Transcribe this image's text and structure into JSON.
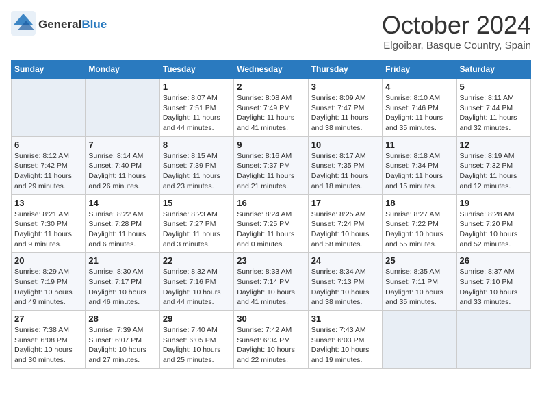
{
  "header": {
    "logo_general": "General",
    "logo_blue": "Blue",
    "month_title": "October 2024",
    "location": "Elgoibar, Basque Country, Spain"
  },
  "columns": [
    "Sunday",
    "Monday",
    "Tuesday",
    "Wednesday",
    "Thursday",
    "Friday",
    "Saturday"
  ],
  "weeks": [
    [
      {
        "day": "",
        "sunrise": "",
        "sunset": "",
        "daylight": ""
      },
      {
        "day": "",
        "sunrise": "",
        "sunset": "",
        "daylight": ""
      },
      {
        "day": "1",
        "sunrise": "Sunrise: 8:07 AM",
        "sunset": "Sunset: 7:51 PM",
        "daylight": "Daylight: 11 hours and 44 minutes."
      },
      {
        "day": "2",
        "sunrise": "Sunrise: 8:08 AM",
        "sunset": "Sunset: 7:49 PM",
        "daylight": "Daylight: 11 hours and 41 minutes."
      },
      {
        "day": "3",
        "sunrise": "Sunrise: 8:09 AM",
        "sunset": "Sunset: 7:47 PM",
        "daylight": "Daylight: 11 hours and 38 minutes."
      },
      {
        "day": "4",
        "sunrise": "Sunrise: 8:10 AM",
        "sunset": "Sunset: 7:46 PM",
        "daylight": "Daylight: 11 hours and 35 minutes."
      },
      {
        "day": "5",
        "sunrise": "Sunrise: 8:11 AM",
        "sunset": "Sunset: 7:44 PM",
        "daylight": "Daylight: 11 hours and 32 minutes."
      }
    ],
    [
      {
        "day": "6",
        "sunrise": "Sunrise: 8:12 AM",
        "sunset": "Sunset: 7:42 PM",
        "daylight": "Daylight: 11 hours and 29 minutes."
      },
      {
        "day": "7",
        "sunrise": "Sunrise: 8:14 AM",
        "sunset": "Sunset: 7:40 PM",
        "daylight": "Daylight: 11 hours and 26 minutes."
      },
      {
        "day": "8",
        "sunrise": "Sunrise: 8:15 AM",
        "sunset": "Sunset: 7:39 PM",
        "daylight": "Daylight: 11 hours and 23 minutes."
      },
      {
        "day": "9",
        "sunrise": "Sunrise: 8:16 AM",
        "sunset": "Sunset: 7:37 PM",
        "daylight": "Daylight: 11 hours and 21 minutes."
      },
      {
        "day": "10",
        "sunrise": "Sunrise: 8:17 AM",
        "sunset": "Sunset: 7:35 PM",
        "daylight": "Daylight: 11 hours and 18 minutes."
      },
      {
        "day": "11",
        "sunrise": "Sunrise: 8:18 AM",
        "sunset": "Sunset: 7:34 PM",
        "daylight": "Daylight: 11 hours and 15 minutes."
      },
      {
        "day": "12",
        "sunrise": "Sunrise: 8:19 AM",
        "sunset": "Sunset: 7:32 PM",
        "daylight": "Daylight: 11 hours and 12 minutes."
      }
    ],
    [
      {
        "day": "13",
        "sunrise": "Sunrise: 8:21 AM",
        "sunset": "Sunset: 7:30 PM",
        "daylight": "Daylight: 11 hours and 9 minutes."
      },
      {
        "day": "14",
        "sunrise": "Sunrise: 8:22 AM",
        "sunset": "Sunset: 7:28 PM",
        "daylight": "Daylight: 11 hours and 6 minutes."
      },
      {
        "day": "15",
        "sunrise": "Sunrise: 8:23 AM",
        "sunset": "Sunset: 7:27 PM",
        "daylight": "Daylight: 11 hours and 3 minutes."
      },
      {
        "day": "16",
        "sunrise": "Sunrise: 8:24 AM",
        "sunset": "Sunset: 7:25 PM",
        "daylight": "Daylight: 11 hours and 0 minutes."
      },
      {
        "day": "17",
        "sunrise": "Sunrise: 8:25 AM",
        "sunset": "Sunset: 7:24 PM",
        "daylight": "Daylight: 10 hours and 58 minutes."
      },
      {
        "day": "18",
        "sunrise": "Sunrise: 8:27 AM",
        "sunset": "Sunset: 7:22 PM",
        "daylight": "Daylight: 10 hours and 55 minutes."
      },
      {
        "day": "19",
        "sunrise": "Sunrise: 8:28 AM",
        "sunset": "Sunset: 7:20 PM",
        "daylight": "Daylight: 10 hours and 52 minutes."
      }
    ],
    [
      {
        "day": "20",
        "sunrise": "Sunrise: 8:29 AM",
        "sunset": "Sunset: 7:19 PM",
        "daylight": "Daylight: 10 hours and 49 minutes."
      },
      {
        "day": "21",
        "sunrise": "Sunrise: 8:30 AM",
        "sunset": "Sunset: 7:17 PM",
        "daylight": "Daylight: 10 hours and 46 minutes."
      },
      {
        "day": "22",
        "sunrise": "Sunrise: 8:32 AM",
        "sunset": "Sunset: 7:16 PM",
        "daylight": "Daylight: 10 hours and 44 minutes."
      },
      {
        "day": "23",
        "sunrise": "Sunrise: 8:33 AM",
        "sunset": "Sunset: 7:14 PM",
        "daylight": "Daylight: 10 hours and 41 minutes."
      },
      {
        "day": "24",
        "sunrise": "Sunrise: 8:34 AM",
        "sunset": "Sunset: 7:13 PM",
        "daylight": "Daylight: 10 hours and 38 minutes."
      },
      {
        "day": "25",
        "sunrise": "Sunrise: 8:35 AM",
        "sunset": "Sunset: 7:11 PM",
        "daylight": "Daylight: 10 hours and 35 minutes."
      },
      {
        "day": "26",
        "sunrise": "Sunrise: 8:37 AM",
        "sunset": "Sunset: 7:10 PM",
        "daylight": "Daylight: 10 hours and 33 minutes."
      }
    ],
    [
      {
        "day": "27",
        "sunrise": "Sunrise: 7:38 AM",
        "sunset": "Sunset: 6:08 PM",
        "daylight": "Daylight: 10 hours and 30 minutes."
      },
      {
        "day": "28",
        "sunrise": "Sunrise: 7:39 AM",
        "sunset": "Sunset: 6:07 PM",
        "daylight": "Daylight: 10 hours and 27 minutes."
      },
      {
        "day": "29",
        "sunrise": "Sunrise: 7:40 AM",
        "sunset": "Sunset: 6:05 PM",
        "daylight": "Daylight: 10 hours and 25 minutes."
      },
      {
        "day": "30",
        "sunrise": "Sunrise: 7:42 AM",
        "sunset": "Sunset: 6:04 PM",
        "daylight": "Daylight: 10 hours and 22 minutes."
      },
      {
        "day": "31",
        "sunrise": "Sunrise: 7:43 AM",
        "sunset": "Sunset: 6:03 PM",
        "daylight": "Daylight: 10 hours and 19 minutes."
      },
      {
        "day": "",
        "sunrise": "",
        "sunset": "",
        "daylight": ""
      },
      {
        "day": "",
        "sunrise": "",
        "sunset": "",
        "daylight": ""
      }
    ]
  ]
}
